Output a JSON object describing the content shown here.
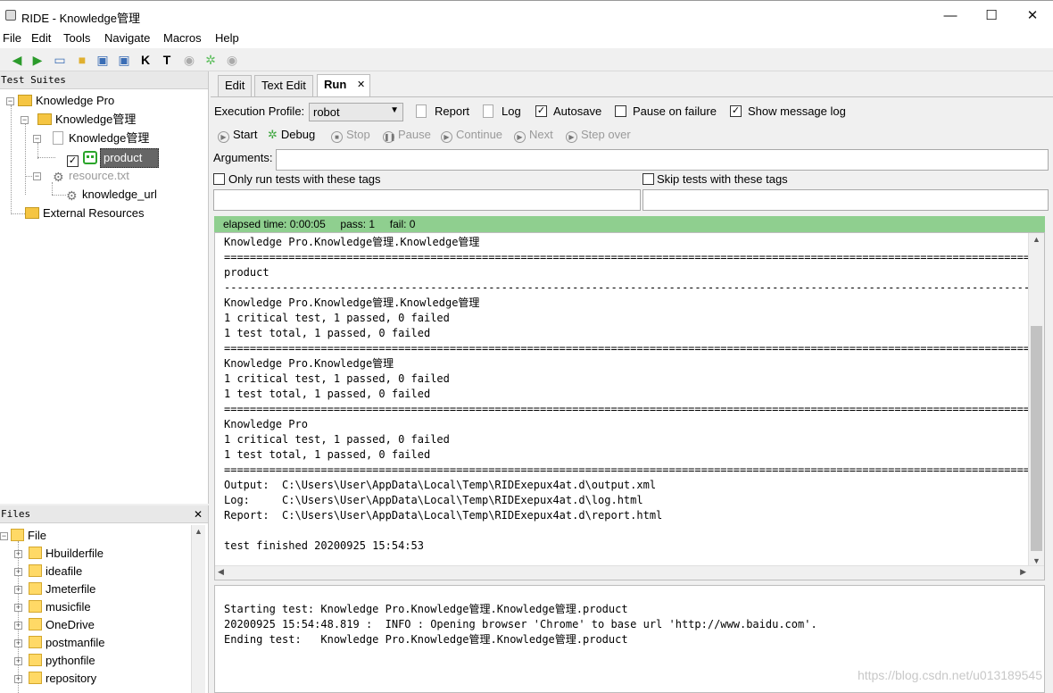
{
  "window": {
    "title": "RIDE - Knowledge管理",
    "minimize": "—",
    "maximize": "☐",
    "close": "✕"
  },
  "menu": [
    "File",
    "Edit",
    "Tools",
    "Navigate",
    "Macros",
    "Help"
  ],
  "toolbar_icons": [
    "back-arrow-icon",
    "forward-arrow-icon",
    "open-folder-icon",
    "new-file-icon",
    "save-icon",
    "save-all-icon",
    "keyword-search-icon",
    "test-search-icon",
    "run-icon",
    "debug-icon",
    "stop-icon"
  ],
  "suites_panel": {
    "header": "Test Suites",
    "tree": {
      "root": "Knowledge Pro",
      "sub": "Knowledge管理",
      "file": "Knowledge管理",
      "test": "product",
      "resource": "resource.txt",
      "variable": "knowledge_url",
      "external": "External Resources"
    }
  },
  "files_panel": {
    "header": "Files",
    "close": "✕",
    "root": "File",
    "items": [
      "Hbuilderfile",
      "ideafile",
      "Jmeterfile",
      "musicfile",
      "OneDrive",
      "postmanfile",
      "pythonfile",
      "repository"
    ]
  },
  "tabs": [
    "Edit",
    "Text Edit",
    "Run"
  ],
  "tab_close": "✕",
  "run": {
    "profile_label": "Execution Profile:",
    "profile_value": "robot",
    "report": "Report",
    "log": "Log",
    "autosave": "Autosave",
    "autosave_checked": true,
    "pause_on_failure": "Pause on failure",
    "pause_checked": false,
    "show_message_log": "Show message log",
    "show_message_checked": true,
    "buttons": {
      "start": "Start",
      "debug": "Debug",
      "stop": "Stop",
      "pause": "Pause",
      "continue": "Continue",
      "next": "Next",
      "step_over": "Step over"
    },
    "arguments_label": "Arguments:",
    "arguments_value": "",
    "only_run_tags": "Only run tests with these tags",
    "skip_tags": "Skip tests with these tags",
    "status": "elapsed time: 0:00:05     pass: 1     fail: 0"
  },
  "console_lines": [
    "Knowledge Pro.Knowledge管理.Knowledge管理",
    "==============================================================================================================================================",
    "product",
    "----------------------------------------------------------------------------------------------------------------------------------------------",
    "Knowledge Pro.Knowledge管理.Knowledge管理",
    "1 critical test, 1 passed, 0 failed",
    "1 test total, 1 passed, 0 failed",
    "==============================================================================================================================================",
    "Knowledge Pro.Knowledge管理",
    "1 critical test, 1 passed, 0 failed",
    "1 test total, 1 passed, 0 failed",
    "==============================================================================================================================================",
    "Knowledge Pro",
    "1 critical test, 1 passed, 0 failed",
    "1 test total, 1 passed, 0 failed",
    "==============================================================================================================================================",
    "Output:  C:\\Users\\User\\AppData\\Local\\Temp\\RIDExepux4at.d\\output.xml",
    "Log:     C:\\Users\\User\\AppData\\Local\\Temp\\RIDExepux4at.d\\log.html",
    "Report:  C:\\Users\\User\\AppData\\Local\\Temp\\RIDExepux4at.d\\report.html",
    "",
    "test finished 20200925 15:54:53"
  ],
  "message_log": [
    "Starting test: Knowledge Pro.Knowledge管理.Knowledge管理.product",
    "20200925 15:54:48.819 :  INFO : Opening browser 'Chrome' to base url 'http://www.baidu.com'.",
    "Ending test:   Knowledge Pro.Knowledge管理.Knowledge管理.product"
  ],
  "watermark": "https://blog.csdn.net/u013189545"
}
